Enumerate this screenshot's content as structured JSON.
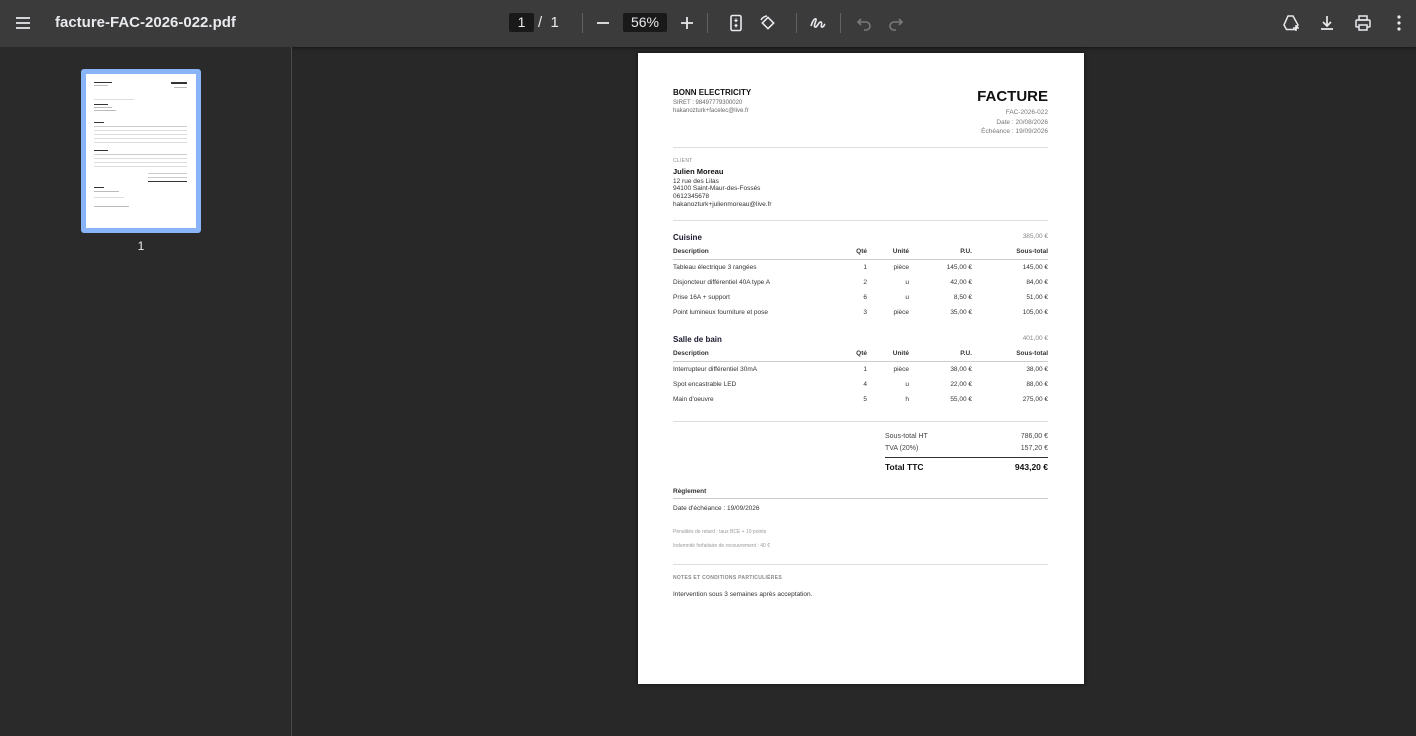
{
  "toolbar": {
    "title": "facture-FAC-2026-022.pdf",
    "page_current": "1",
    "page_sep": "/",
    "page_total": "1",
    "zoom": "56%"
  },
  "sidebar": {
    "thumb_label": "1"
  },
  "invoice": {
    "company": "BONN ELECTRICITY",
    "siret": "SIRET : 98497779300020",
    "company_email": "hakanozturk+facelec@live.fr",
    "doc_title": "FACTURE",
    "number": "FAC-2026-022",
    "date": "Date : 20/08/2026",
    "due": "Échéance : 19/09/2026",
    "client_label": "CLIENT",
    "client_name": "Julien Moreau",
    "client_address1": "12 rue des Lilas",
    "client_address2": "94100 Saint-Maur-des-Fossés",
    "client_phone": "0612345678",
    "client_email": "hakanozturk+julienmoreau@live.fr",
    "headers": {
      "desc": "Description",
      "qty": "Qté",
      "unit": "Unité",
      "pu": "P.U.",
      "subtotal": "Sous-total"
    },
    "sections": [
      {
        "title": "Cuisine",
        "total": "385,00 €",
        "rows": [
          {
            "desc": "Tableau électrique 3 rangées",
            "qty": "1",
            "unit": "pièce",
            "pu": "145,00 €",
            "subtotal": "145,00 €"
          },
          {
            "desc": "Disjoncteur différentiel 40A type A",
            "qty": "2",
            "unit": "u",
            "pu": "42,00 €",
            "subtotal": "84,00 €"
          },
          {
            "desc": "Prise 16A + support",
            "qty": "6",
            "unit": "u",
            "pu": "8,50 €",
            "subtotal": "51,00 €"
          },
          {
            "desc": "Point lumineux fourniture et pose",
            "qty": "3",
            "unit": "pièce",
            "pu": "35,00 €",
            "subtotal": "105,00 €"
          }
        ]
      },
      {
        "title": "Salle de bain",
        "total": "401,00 €",
        "rows": [
          {
            "desc": "Interrupteur différentiel 30mA",
            "qty": "1",
            "unit": "pièce",
            "pu": "38,00 €",
            "subtotal": "38,00 €"
          },
          {
            "desc": "Spot encastrable LED",
            "qty": "4",
            "unit": "u",
            "pu": "22,00 €",
            "subtotal": "88,00 €"
          },
          {
            "desc": "Main d'oeuvre",
            "qty": "5",
            "unit": "h",
            "pu": "55,00 €",
            "subtotal": "275,00 €"
          }
        ]
      }
    ],
    "totals": {
      "ht_label": "Sous-total HT",
      "ht_value": "786,00 €",
      "tva_label": "TVA (20%)",
      "tva_value": "157,20 €",
      "ttc_label": "Total TTC",
      "ttc_value": "943,20 €"
    },
    "payment": {
      "title": "Règlement",
      "due_line": "Date d'échéance : 19/09/2026",
      "penalty": "Pénalités de retard : taux BCE + 10 points",
      "indemnity": "Indemnité forfaitaire de recouvrement : 40 €"
    },
    "notes": {
      "title": "NOTES ET CONDITIONS PARTICULIÈRES",
      "text": "Intervention sous 3 semaines après acceptation."
    }
  }
}
